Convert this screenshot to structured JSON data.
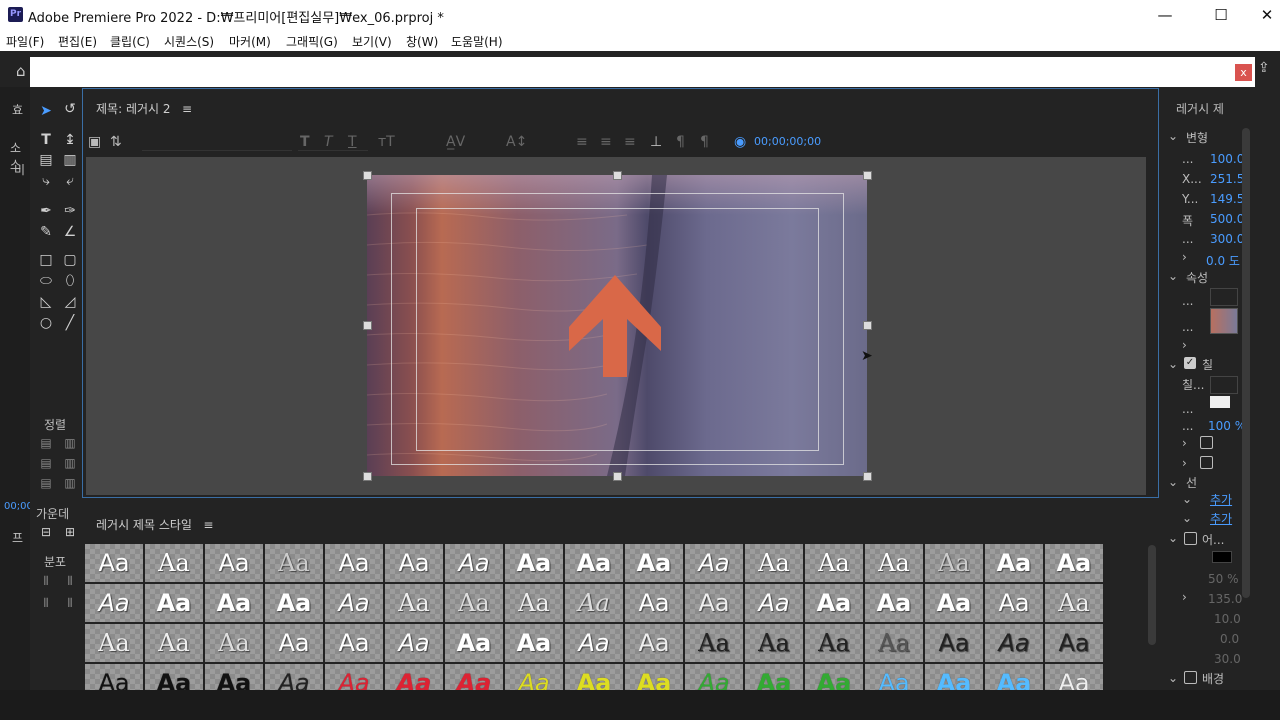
{
  "window": {
    "app_icon": "Pr",
    "title": "Adobe Premiere Pro 2022 - D:₩프리미어[편집실무]₩ex_06.prproj *",
    "minimize": "—",
    "maximize": "☐",
    "close": "✕"
  },
  "menu": [
    "파일(F)",
    "편집(E)",
    "클립(C)",
    "시퀀스(S)",
    "마커(M)",
    "그래픽(G)",
    "보기(V)",
    "창(W)",
    "도움말(H)"
  ],
  "dialog": {
    "close_label": "x"
  },
  "title_panel": {
    "title": "제목: 레거시 2",
    "menu_icon": "≡",
    "timecode": "00;00;00;00"
  },
  "left_side": {
    "effects_tab": "효",
    "source_label": "소스",
    "bi_label": "비",
    "align_label": "정렬",
    "center_label": "가운데",
    "distribute_label": "분포",
    "timecode_small": "00;00",
    "project_label": "프"
  },
  "styles_panel": {
    "title": "레거시 제목 스타일",
    "menu_icon": "≡",
    "sample": "Aa"
  },
  "properties": {
    "header": "레거시 제",
    "transform": "변형",
    "opacity_value": "100.0",
    "x_label": "X...",
    "x_value": "251.5",
    "y_label": "Y...",
    "y_value": "149.5",
    "width_label": "폭",
    "width_value": "500.0",
    "height_value": "300.0",
    "rotation_value": "0.0 도",
    "attributes": "속성",
    "fill_section": "칠",
    "fill_type": "칠...",
    "fill_opacity": "100 %",
    "stroke_section": "선",
    "add1": "추가",
    "add2": "추가",
    "shadow_section": "어...",
    "shadow_opacity": "50 %",
    "shadow_angle": "135.0",
    "shadow_distance": "10.0",
    "shadow_size": "0.0",
    "shadow_spread": "30.0",
    "background_section": "배경"
  }
}
